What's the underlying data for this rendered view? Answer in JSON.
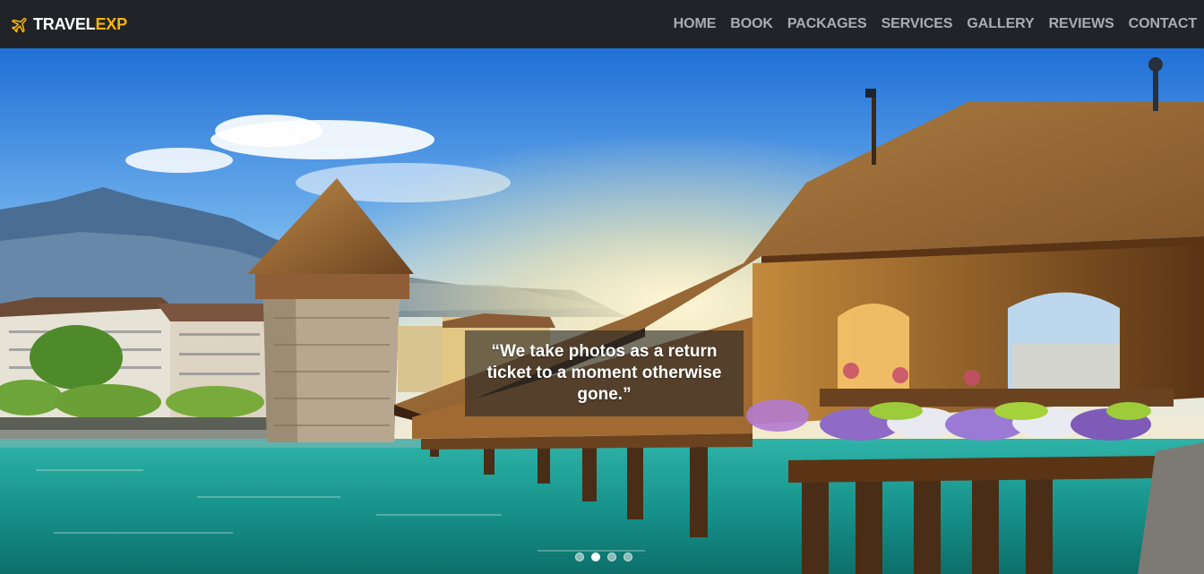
{
  "brand": {
    "name_part1": "TRAVEL",
    "name_part2": "EXP",
    "icon": "plane-icon",
    "accent": "#f5b50a"
  },
  "nav": {
    "items": [
      {
        "label": "HOME"
      },
      {
        "label": "BOOK"
      },
      {
        "label": "PACKAGES"
      },
      {
        "label": "SERVICES"
      },
      {
        "label": "GALLERY"
      },
      {
        "label": "REVIEWS"
      },
      {
        "label": "CONTACT"
      }
    ]
  },
  "hero": {
    "caption": "“We take photos as a return ticket to a moment otherwise gone.”",
    "slide_count": 4,
    "active_slide": 2
  }
}
